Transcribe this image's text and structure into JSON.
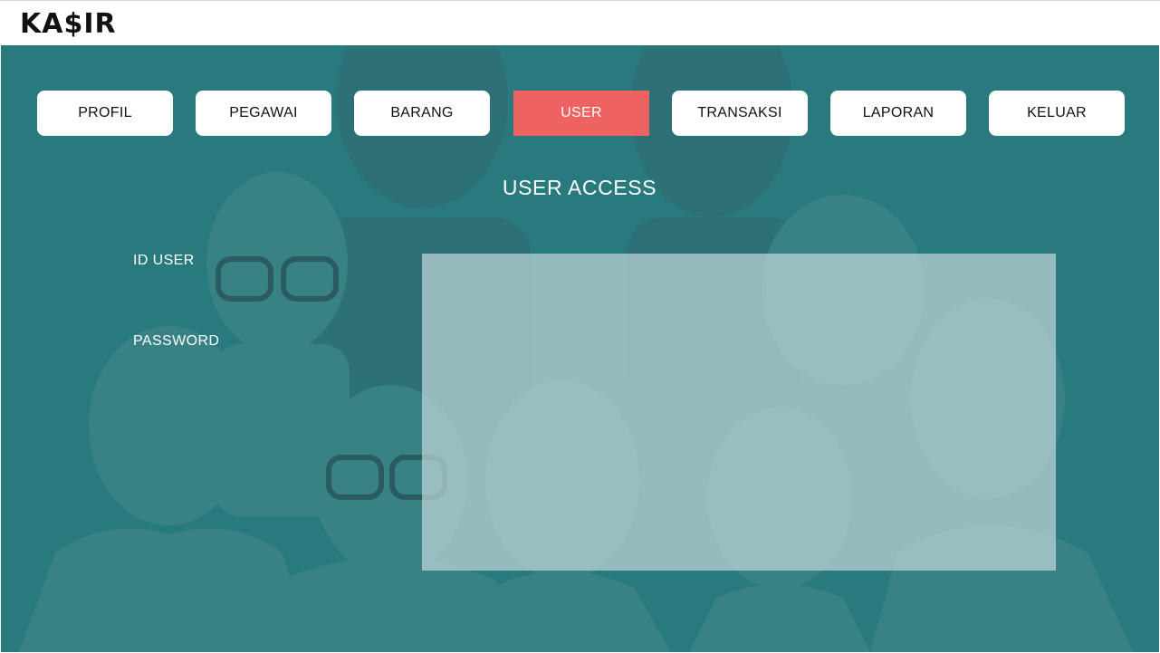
{
  "app": {
    "logo": "KA$IR"
  },
  "nav": {
    "items": [
      {
        "label": "PROFIL"
      },
      {
        "label": "PEGAWAI"
      },
      {
        "label": "BARANG"
      },
      {
        "label": "USER",
        "active": true
      },
      {
        "label": "TRANSAKSI"
      },
      {
        "label": "LAPORAN"
      },
      {
        "label": "KELUAR"
      }
    ]
  },
  "main": {
    "title": "USER ACCESS",
    "fields": {
      "id_user_label": "ID USER",
      "password_label": "PASSWORD"
    }
  },
  "colors": {
    "background": "#287a7e",
    "active_tab": "#ef6262",
    "button": "#ffffff",
    "panel": "#bed6d8"
  }
}
